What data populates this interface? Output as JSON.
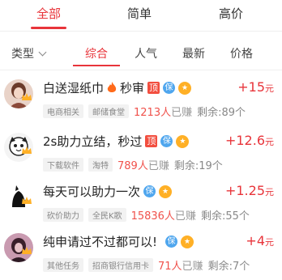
{
  "top_tabs": [
    {
      "label": "全部",
      "active": true
    },
    {
      "label": "简单",
      "active": false
    },
    {
      "label": "高价",
      "active": false
    }
  ],
  "type_filter": {
    "label": "类型"
  },
  "sort_tabs": [
    {
      "label": "综合",
      "active": true
    },
    {
      "label": "人气",
      "active": false
    },
    {
      "label": "最新",
      "active": false
    },
    {
      "label": "价格",
      "active": false
    }
  ],
  "tasks": [
    {
      "title_a": "白送湿纸巾",
      "title_b": "秒审",
      "has_fire": true,
      "top_badge": "顶",
      "bao": "保",
      "tags": [
        "电商相关",
        "邮储食堂"
      ],
      "count": "1213人",
      "earned": "已赚",
      "remaining": "剩余:89个",
      "reward_value": "+15",
      "reward_unit": "元"
    },
    {
      "title_a": "2s助力立结，秒过",
      "title_b": "",
      "has_fire": false,
      "top_badge": "顶",
      "bao": "保",
      "tags": [
        "下载软件",
        "淘特"
      ],
      "count": "789人",
      "earned": "已赚",
      "remaining": "剩余:19个",
      "reward_value": "+12.6",
      "reward_unit": "元"
    },
    {
      "title_a": "每天可以助力一次",
      "title_b": "",
      "has_fire": false,
      "top_badge": "",
      "bao": "保",
      "tags": [
        "砍价助力",
        "全民K歌"
      ],
      "count": "15836人",
      "earned": "已赚",
      "remaining": "剩余:55个",
      "reward_value": "+1.25",
      "reward_unit": "元"
    },
    {
      "title_a": "纯申请过不过都可以!",
      "title_b": "",
      "has_fire": false,
      "top_badge": "",
      "bao": "保",
      "tags": [
        "其他任务",
        "招商银行信用卡"
      ],
      "count": "71人",
      "earned": "已赚",
      "remaining": "剩余:7个",
      "reward_value": "+4",
      "reward_unit": "元"
    }
  ],
  "colors": {
    "accent": "#e8343a",
    "bao": "#4fa6ee",
    "bonus": "#ffb026"
  }
}
